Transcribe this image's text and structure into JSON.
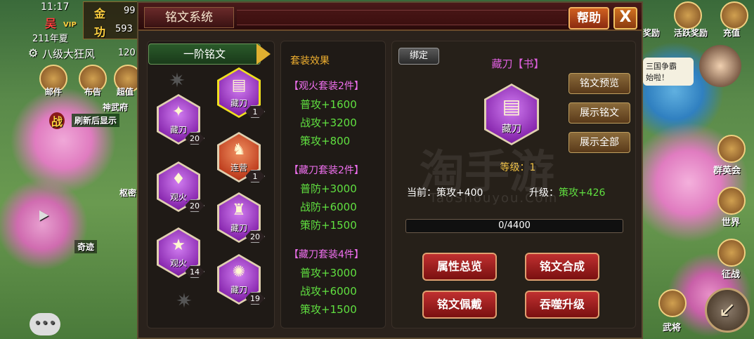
{
  "hud": {
    "time": "11:17",
    "faction": "吴",
    "year": "211年夏",
    "gold_label": "金",
    "gold_value": "99",
    "merit_label": "功",
    "merit_value": "593",
    "vip": "VIP",
    "rank_title": "八级大狂风",
    "rank_value": "120",
    "mail": "邮件",
    "notice": "布告",
    "super_value": "超值",
    "shenwu": "神武府",
    "refresh": "刷新后显示",
    "zhan": "战",
    "shumi": "枢密",
    "miracle": "奇迹",
    "right_top": [
      "奖励",
      "活跃奖励",
      "充值"
    ],
    "news": "三国争霸\n始啦！",
    "right_side": [
      "群英会",
      "世界",
      "征战",
      "武将"
    ]
  },
  "dialog": {
    "title": "铭文系统",
    "help": "帮助",
    "close": "X"
  },
  "left": {
    "tier": "一阶铭文",
    "gems": [
      {
        "name": "藏刀",
        "count": "20",
        "color": "purple",
        "symbol": "✦"
      },
      {
        "name": "藏刀",
        "count": "1",
        "color": "purple",
        "symbol": "▤",
        "selected": true
      },
      {
        "name": "连营",
        "count": "1",
        "color": "orange",
        "symbol": "♞"
      },
      {
        "name": "观火",
        "count": "20",
        "color": "purple",
        "symbol": "♦"
      },
      {
        "name": "藏刀",
        "count": "20",
        "color": "purple",
        "symbol": "♜"
      },
      {
        "name": "观火",
        "count": "14",
        "color": "purple",
        "symbol": "★"
      },
      {
        "name": "藏刀",
        "count": "19",
        "color": "purple",
        "symbol": "✺"
      }
    ]
  },
  "sets": {
    "header": "套装效果",
    "groups": [
      {
        "title": "【观火套装2件】",
        "lines": [
          "普攻+1600",
          "战攻+3200",
          "策攻+800"
        ]
      },
      {
        "title": "【藏刀套装2件】",
        "lines": [
          "普防+3000",
          "战防+6000",
          "策防+1500"
        ]
      },
      {
        "title": "【藏刀套装4件】",
        "lines": [
          "普攻+3000",
          "战攻+6000",
          "策攻+1500"
        ]
      }
    ]
  },
  "detail": {
    "bind": "绑定",
    "name": "藏刀【书】",
    "gem_label": "藏刀",
    "level": "等级：1",
    "current_label": "当前：",
    "current_value": "策攻+400",
    "upgrade_label": "升级：",
    "upgrade_value": "策攻+426",
    "progress_text": "0/4400",
    "progress": 0,
    "side_buttons": [
      "铭文预览",
      "展示铭文",
      "展示全部"
    ],
    "actions": [
      "属性总览",
      "铭文合成",
      "铭文佩戴",
      "吞噬升级"
    ]
  },
  "watermark": {
    "cn": "淘手游",
    "en": "TaoShouyou.Com"
  }
}
